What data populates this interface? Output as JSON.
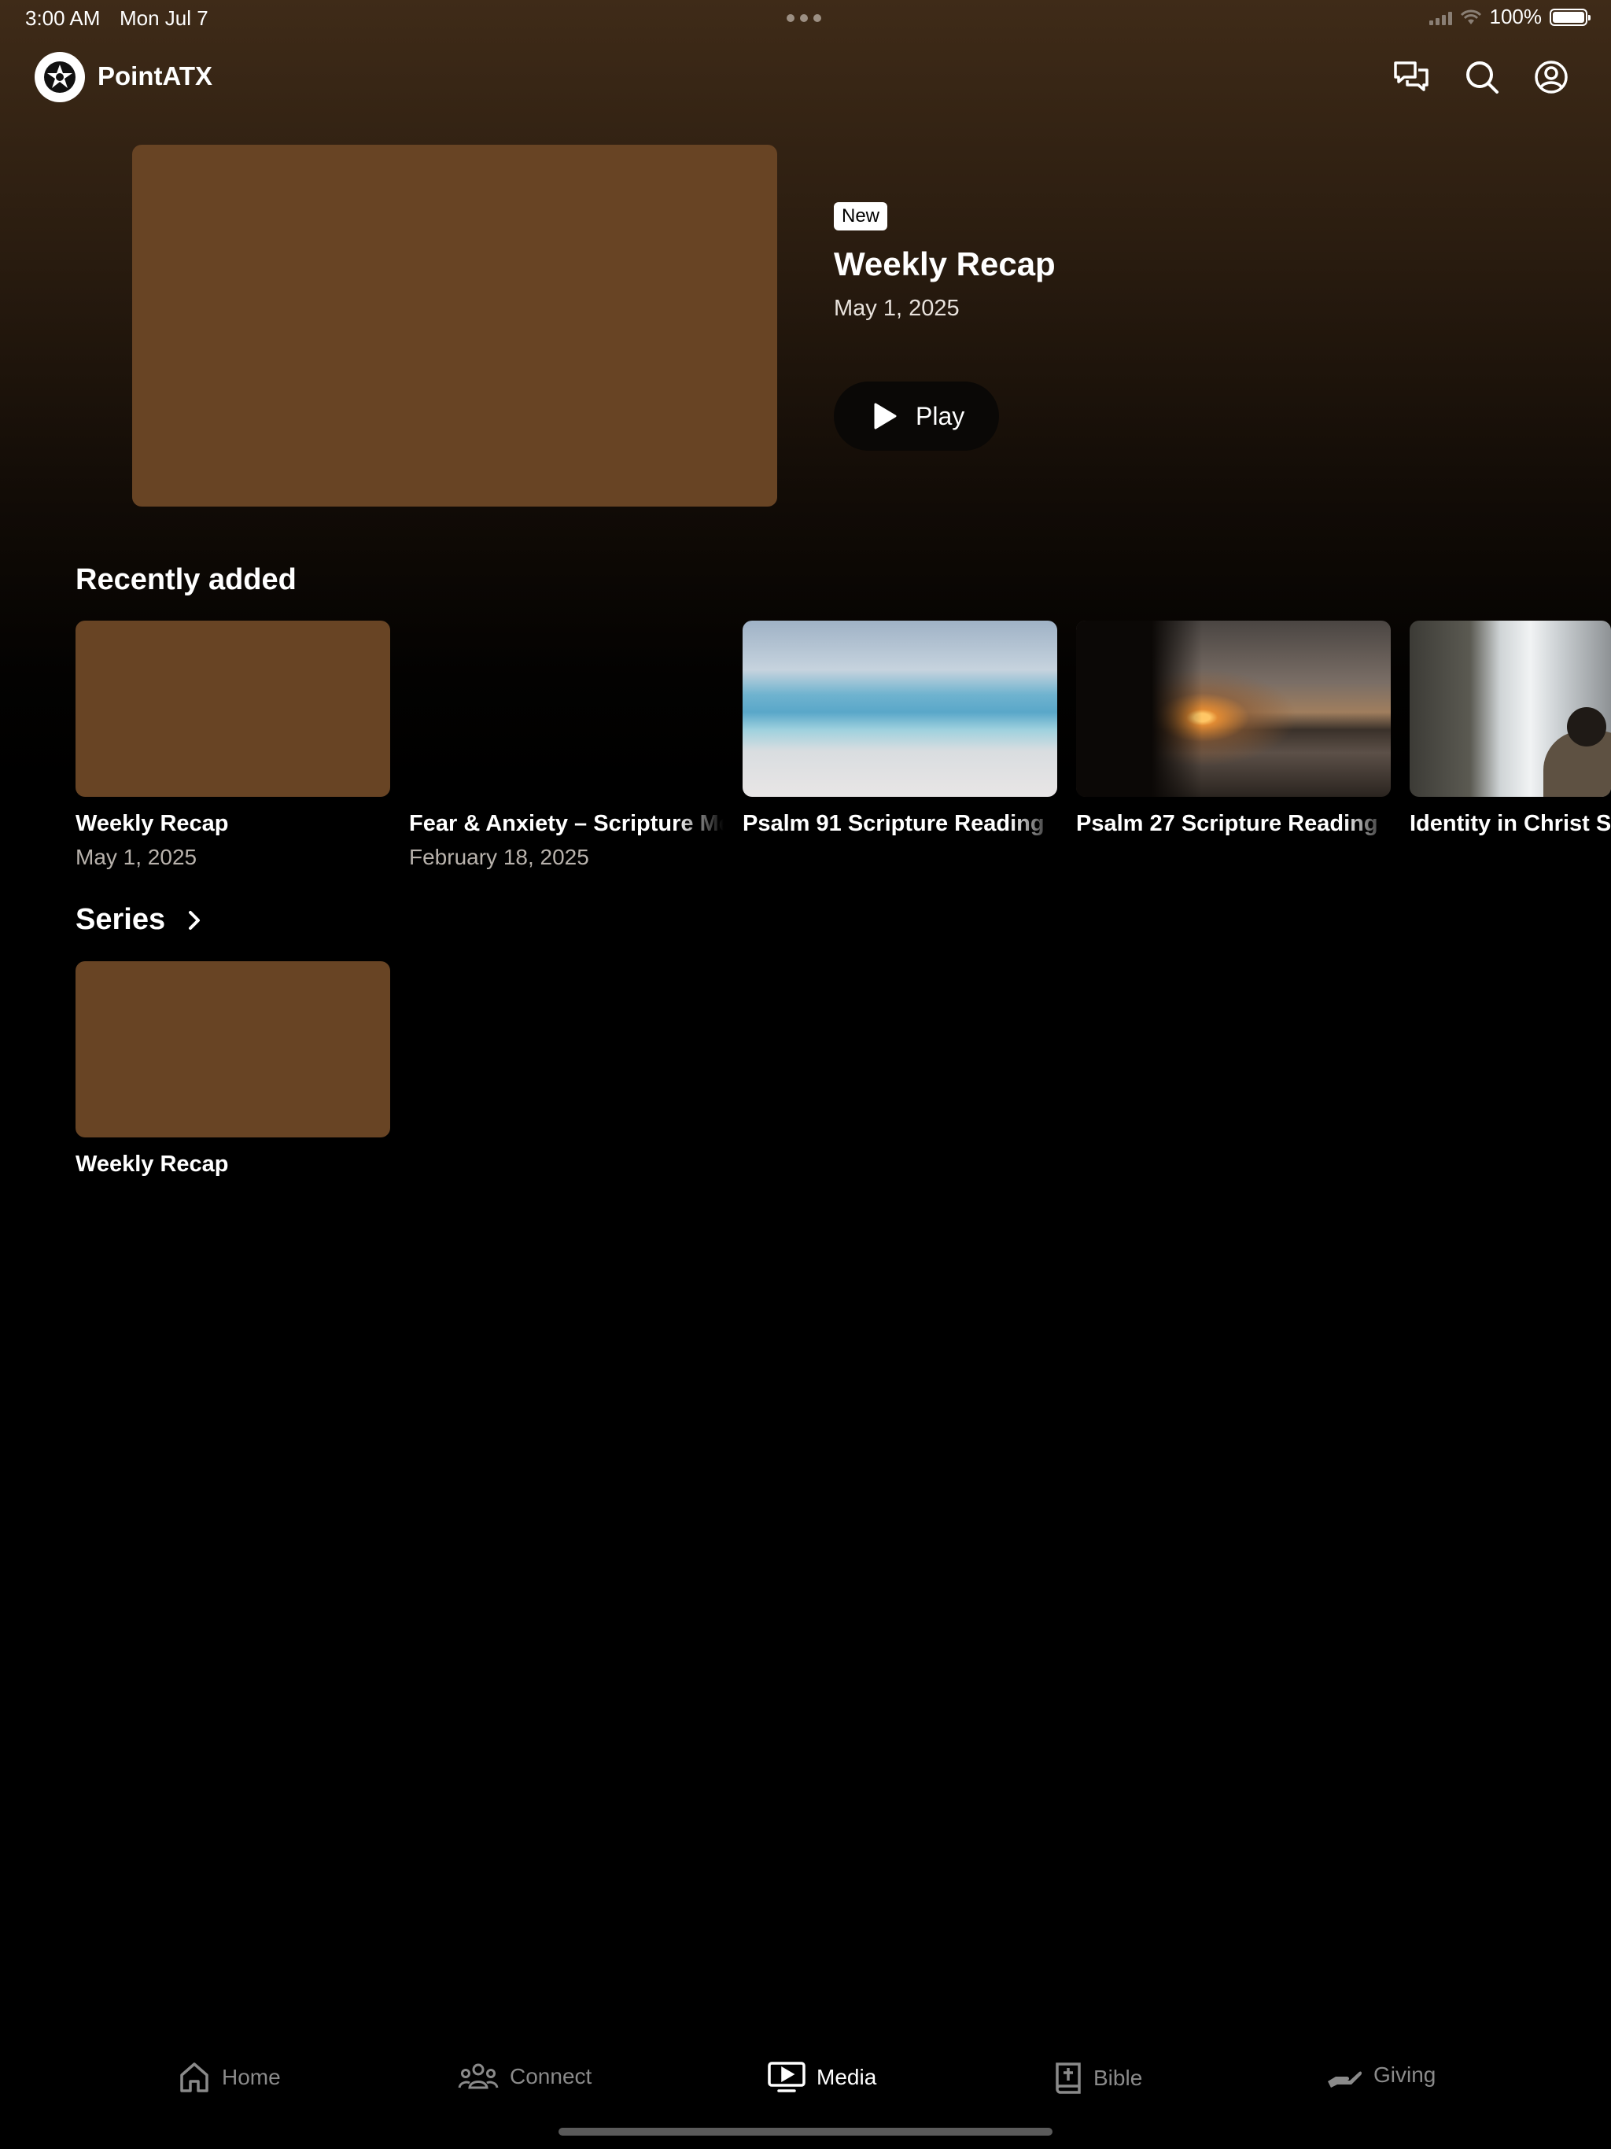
{
  "status_bar": {
    "time": "3:00 AM",
    "date": "Mon Jul 7",
    "battery": "100%"
  },
  "header": {
    "app_name": "PointATX",
    "icons": [
      "chat-icon",
      "search-icon",
      "account-icon"
    ]
  },
  "hero": {
    "badge": "New",
    "title": "Weekly Recap",
    "date": "May 1, 2025",
    "play_label": "Play"
  },
  "recently_added": {
    "heading": "Recently added",
    "items": [
      {
        "title": "Weekly Recap",
        "date": "May 1, 2025"
      },
      {
        "title": "Fear & Anxiety – Scripture Meditation",
        "date": "February 18, 2025"
      },
      {
        "title": "Psalm 91 Scripture Reading",
        "date": ""
      },
      {
        "title": "Psalm 27 Scripture Reading",
        "date": ""
      },
      {
        "title": "Identity in Christ S",
        "date": ""
      }
    ]
  },
  "series": {
    "heading": "Series",
    "items": [
      {
        "title": "Weekly Recap"
      }
    ]
  },
  "tab_bar": {
    "tabs": [
      {
        "label": "Home",
        "icon": "home-icon"
      },
      {
        "label": "Connect",
        "icon": "people-icon"
      },
      {
        "label": "Media",
        "icon": "tv-play-icon",
        "active": true
      },
      {
        "label": "Bible",
        "icon": "bible-icon"
      },
      {
        "label": "Giving",
        "icon": "giving-hand-icon"
      }
    ]
  },
  "colors": {
    "placeholder_thumb": "#684424",
    "header_gradient_top": "#3f2b18",
    "background": "#000000"
  }
}
